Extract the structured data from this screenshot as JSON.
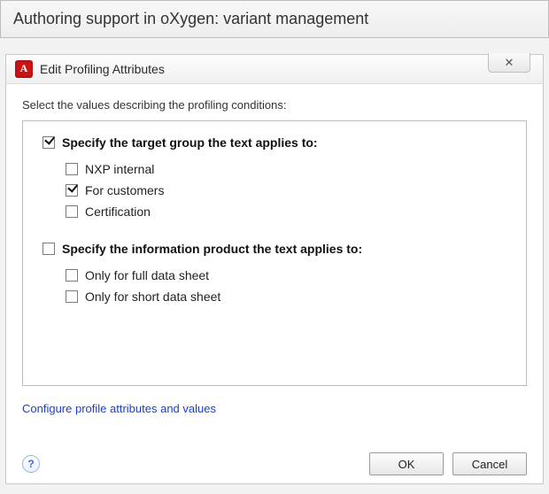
{
  "outer": {
    "title": "Authoring support in oXygen: variant management"
  },
  "dialog": {
    "title": "Edit Profiling Attributes",
    "close_glyph": "✕",
    "instruction": "Select the values describing the profiling conditions:",
    "groups": [
      {
        "checked": true,
        "label": "Specify the target group the text applies to:",
        "options": [
          {
            "checked": false,
            "label": "NXP internal"
          },
          {
            "checked": true,
            "label": "For customers"
          },
          {
            "checked": false,
            "label": "Certification"
          }
        ]
      },
      {
        "checked": false,
        "label": "Specify the information product the text applies to:",
        "options": [
          {
            "checked": false,
            "label": "Only for full data sheet"
          },
          {
            "checked": false,
            "label": "Only for short data sheet"
          }
        ]
      }
    ],
    "link": "Configure profile attributes and values",
    "help_glyph": "?",
    "ok": "OK",
    "cancel": "Cancel"
  }
}
